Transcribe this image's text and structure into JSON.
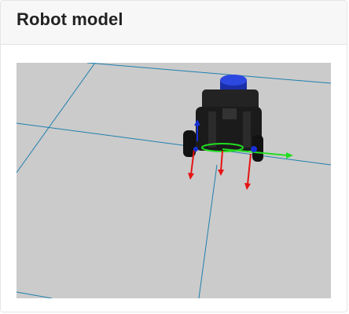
{
  "panel": {
    "title": "Robot model"
  },
  "viewport": {
    "background_color": "#cbcbcb",
    "grid_color": "#1f7fae",
    "robot_body_color": "#1c1c1c",
    "lidar_color": "#1730b8",
    "axis_x_color": "#e51414",
    "axis_y_color": "#22dd22",
    "axis_z_color": "#1730d8"
  }
}
